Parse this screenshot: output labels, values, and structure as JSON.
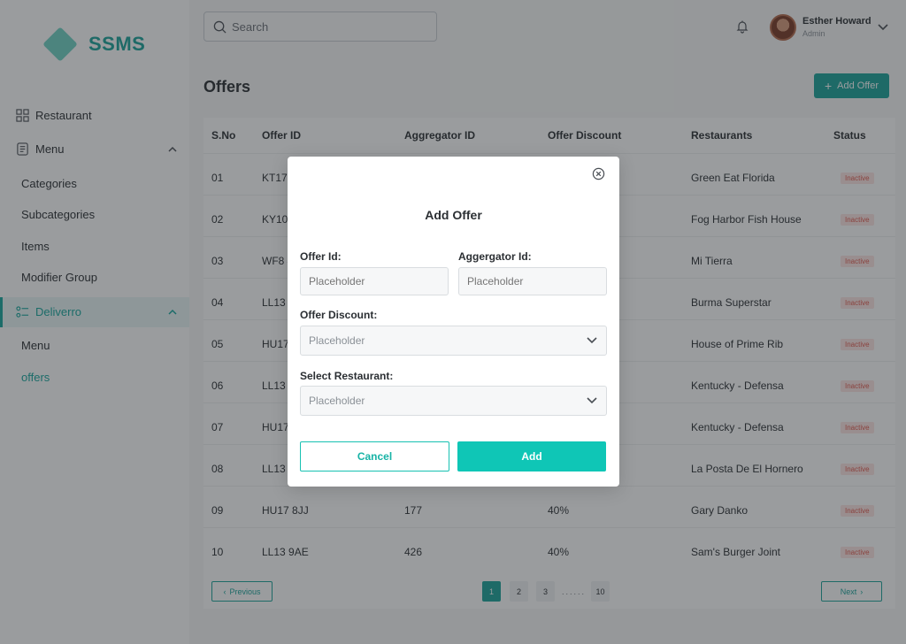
{
  "app": {
    "name": "SSMS"
  },
  "sidebar": {
    "restaurant": "Restaurant",
    "menu": "Menu",
    "menu_children": [
      "Categories",
      "Subcategories",
      "Items",
      "Modifier Group"
    ],
    "deliverro": "Deliverro",
    "deliverro_children": [
      "Menu",
      "offers"
    ]
  },
  "topbar": {
    "search_placeholder": "Search",
    "user_name": "Esther Howard",
    "user_role": "Admin"
  },
  "page": {
    "title": "Offers",
    "add_button": "Add Offer"
  },
  "table": {
    "headers": [
      "S.No",
      "Offer ID",
      "Aggregator ID",
      "Offer Discount",
      "Restaurants",
      "Status"
    ],
    "rows": [
      {
        "sno": "01",
        "offer_id": "KT17",
        "aggregator_id": "",
        "discount": "",
        "restaurant": "Green Eat Florida",
        "status": "Inactive"
      },
      {
        "sno": "02",
        "offer_id": "KY10",
        "aggregator_id": "",
        "discount": "",
        "restaurant": "Fog Harbor Fish House",
        "status": "Inactive"
      },
      {
        "sno": "03",
        "offer_id": "WF8 4",
        "aggregator_id": "",
        "discount": "",
        "restaurant": "Mi Tierra",
        "status": "Inactive"
      },
      {
        "sno": "04",
        "offer_id": "LL13",
        "aggregator_id": "",
        "discount": "",
        "restaurant": "Burma Superstar",
        "status": "Inactive"
      },
      {
        "sno": "05",
        "offer_id": "HU17",
        "aggregator_id": "",
        "discount": "",
        "restaurant": "House of Prime Rib",
        "status": "Inactive"
      },
      {
        "sno": "06",
        "offer_id": "LL13",
        "aggregator_id": "",
        "discount": "",
        "restaurant": "Kentucky - Defensa",
        "status": "Inactive"
      },
      {
        "sno": "07",
        "offer_id": "HU17",
        "aggregator_id": "",
        "discount": "",
        "restaurant": "Kentucky - Defensa",
        "status": "Inactive"
      },
      {
        "sno": "08",
        "offer_id": "LL13",
        "aggregator_id": "",
        "discount": "",
        "restaurant": "La Posta De El Hornero",
        "status": "Inactive"
      },
      {
        "sno": "09",
        "offer_id": "HU17 8JJ",
        "aggregator_id": "177",
        "discount": "40%",
        "restaurant": "Gary Danko",
        "status": "Inactive"
      },
      {
        "sno": "10",
        "offer_id": "LL13 9AE",
        "aggregator_id": "426",
        "discount": "40%",
        "restaurant": "Sam's Burger Joint",
        "status": "Inactive"
      }
    ]
  },
  "pagination": {
    "previous": "Previous",
    "next": "Next",
    "pages": [
      "1",
      "2",
      "3",
      "10"
    ],
    "dots": "......",
    "current": "1"
  },
  "modal": {
    "title": "Add Offer",
    "offer_id_label": "Offer Id:",
    "offer_id_placeholder": "Placeholder",
    "aggregator_id_label": "Aggergator Id:",
    "aggregator_id_placeholder": "Placeholder",
    "discount_label": "Offer Discount:",
    "discount_placeholder": "Placeholder",
    "restaurant_label": "Select Restaurant:",
    "restaurant_placeholder": "Placeholder",
    "cancel": "Cancel",
    "add": "Add"
  },
  "colors": {
    "accent": "#1aa39a",
    "primary_button": "#0fc6b6",
    "inactive_text": "#e15a4f",
    "inactive_bg": "#fde6e3"
  }
}
